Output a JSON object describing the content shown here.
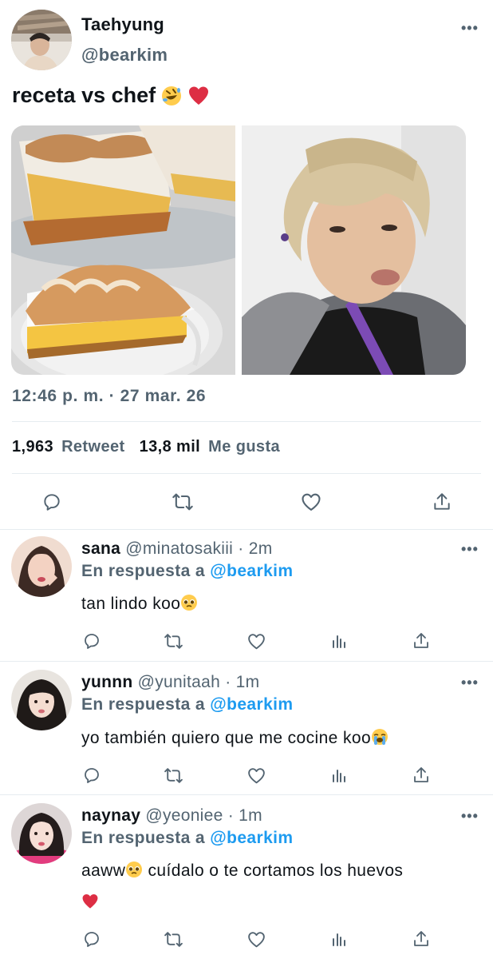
{
  "tweet": {
    "author_name": "Taehyung",
    "author_handle": "@bearkim",
    "text": "receta vs chef",
    "text_emojis": [
      "rolling-laughing-emoji",
      "red-heart-emoji"
    ],
    "timestamp": "12:46 p. m. · 27 mar. 26",
    "retweets_count": "1,963",
    "retweets_label": "Retweet",
    "likes_count": "13,8 mil",
    "likes_label": "Me gusta",
    "images": [
      {
        "subject": "lemon meringue pie slices on plate"
      },
      {
        "subject": "person with light blond hair and grey fur collar"
      }
    ],
    "more_icon": "more-icon",
    "actions": [
      "reply-icon",
      "retweet-icon",
      "like-icon",
      "share-icon"
    ]
  },
  "replies": [
    {
      "name": "sana",
      "handle": "@minatosakiii",
      "time": "· 2m",
      "reply_prefix": "En respuesta a",
      "reply_mention": "@bearkim",
      "text": "tan lindo koo",
      "emoji": "pleading-face-emoji",
      "actions": [
        "reply-icon",
        "retweet-icon",
        "like-icon",
        "analytics-icon",
        "share-icon"
      ]
    },
    {
      "name": "yunnn",
      "handle": "@yunitaah",
      "time": "· 1m",
      "reply_prefix": "En respuesta a",
      "reply_mention": "@bearkim",
      "text": "yo también quiero que me cocine koo",
      "emoji": "loudly-crying-emoji",
      "actions": [
        "reply-icon",
        "retweet-icon",
        "like-icon",
        "analytics-icon",
        "share-icon"
      ]
    },
    {
      "name": "naynay",
      "handle": "@yeoniee",
      "time": "· 1m",
      "reply_prefix": "En respuesta a",
      "reply_mention": "@bearkim",
      "text_part1": "aaww",
      "text_part2": " cuídalo o te cortamos los huevos",
      "emojis": [
        "pleading-face-emoji",
        "red-heart-emoji"
      ],
      "actions": [
        "reply-icon",
        "retweet-icon",
        "like-icon",
        "analytics-icon",
        "share-icon"
      ]
    }
  ],
  "colors": {
    "text_primary": "#0f1419",
    "text_secondary": "#536471",
    "link": "#1d9bf0",
    "divider": "#e6ecf0"
  }
}
